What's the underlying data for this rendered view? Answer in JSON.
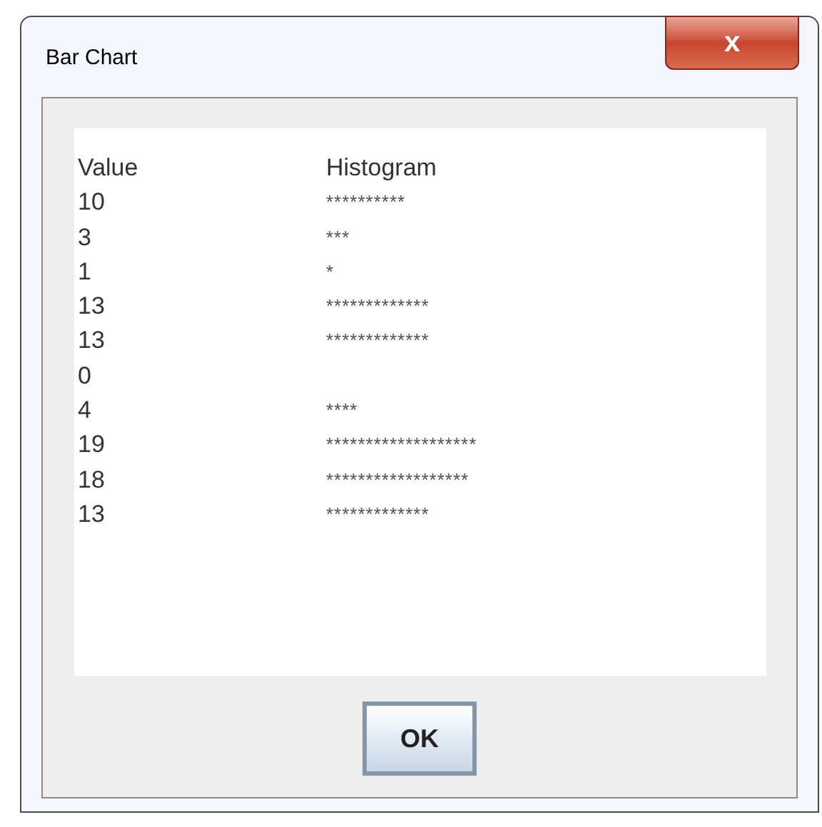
{
  "window": {
    "title": "Bar Chart",
    "close_label": "x"
  },
  "table": {
    "columns": [
      "Value",
      "Histogram"
    ],
    "rows": [
      {
        "value": "10",
        "histogram": "**********"
      },
      {
        "value": "3",
        "histogram": "***"
      },
      {
        "value": "1",
        "histogram": "*"
      },
      {
        "value": "13",
        "histogram": "*************"
      },
      {
        "value": "13",
        "histogram": "*************"
      },
      {
        "value": "0",
        "histogram": ""
      },
      {
        "value": "4",
        "histogram": "****"
      },
      {
        "value": "19",
        "histogram": "*******************"
      },
      {
        "value": "18",
        "histogram": "******************"
      },
      {
        "value": "13",
        "histogram": "*************"
      }
    ]
  },
  "buttons": [
    "OK"
  ]
}
